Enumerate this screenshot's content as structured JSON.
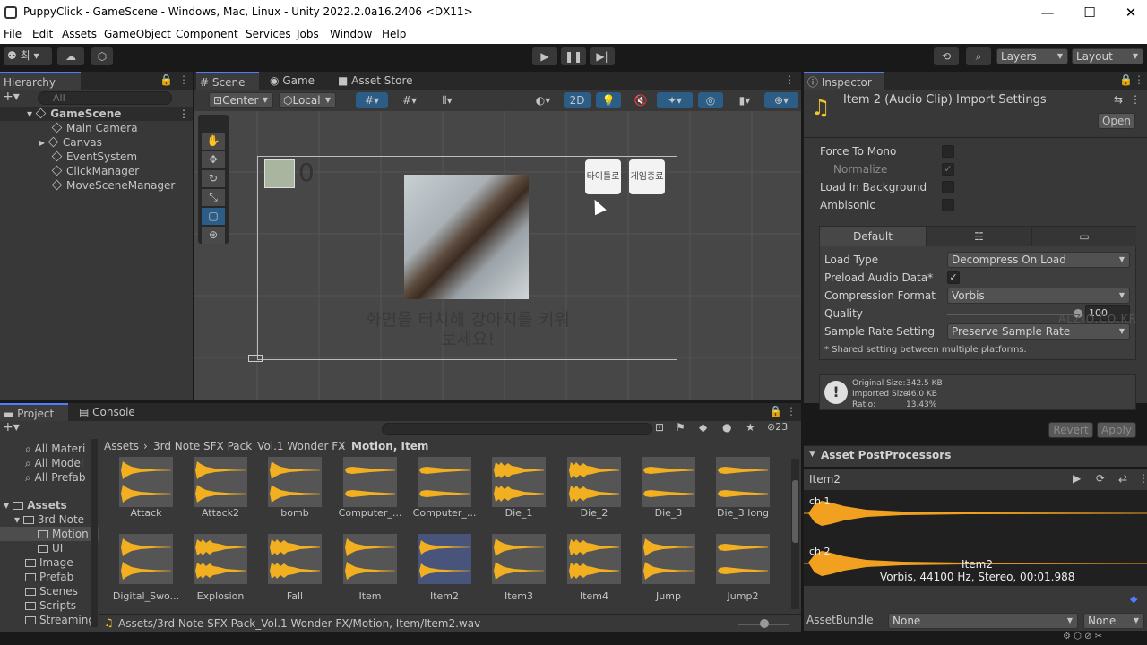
{
  "window": {
    "title": "PuppyClick - GameScene - Windows, Mac, Linux - Unity 2022.2.0a16.2406 <DX11>",
    "minimize": "—",
    "maximize": "☐",
    "close": "✕"
  },
  "menu": [
    "File",
    "Edit",
    "Assets",
    "GameObject",
    "Component",
    "Services",
    "Jobs",
    "Window",
    "Help"
  ],
  "toolbar": {
    "account": "최",
    "layers": "Layers",
    "layout": "Layout"
  },
  "hierarchy": {
    "tab": "Hierarchy",
    "search_placeholder": "All",
    "scene": "GameScene",
    "items": [
      "Main Camera",
      "Canvas",
      "EventSystem",
      "ClickManager",
      "MoveSceneManager"
    ]
  },
  "scene_view": {
    "tabs": [
      "Scene",
      "Game",
      "Asset Store"
    ],
    "pivot": "Center",
    "space": "Local",
    "mode_2d": "2D",
    "score": "0",
    "button_title": "타이틀로",
    "button_quit": "게임종료",
    "instruction": "화면을 터치해 강아지를 키워보세요!"
  },
  "inspector": {
    "tab": "Inspector",
    "title": "Item 2 (Audio Clip) Import Settings",
    "open": "Open",
    "force_to_mono": "Force To Mono",
    "normalize": "Normalize",
    "load_in_background": "Load In Background",
    "ambisonic": "Ambisonic",
    "platform_default": "Default",
    "load_type_label": "Load Type",
    "load_type": "Decompress On Load",
    "preload_label": "Preload Audio Data*",
    "compression_label": "Compression Format",
    "compression": "Vorbis",
    "quality_label": "Quality",
    "quality": "100",
    "quality_fraction": 1.0,
    "sample_rate_label": "Sample Rate Setting",
    "sample_rate": "Preserve Sample Rate",
    "shared_note": "* Shared setting between multiple platforms.",
    "original_size": "Original Size:",
    "original_size_val": "342.5 KB",
    "imported_size": "Imported Size:",
    "imported_size_val": "46.0 KB",
    "ratio": "Ratio:",
    "ratio_val": "13.43%",
    "revert": "Revert",
    "apply": "Apply",
    "postprocessors": "Asset PostProcessors",
    "watermark": "ALZIO.CO.KR"
  },
  "preview": {
    "name": "Item2",
    "ch1": "ch 1",
    "ch2": "ch 2",
    "clip_name": "Item2",
    "info": "Vorbis, 44100 Hz, Stereo, 00:01.988",
    "assetbundle_label": "AssetBundle",
    "assetbundle": "None",
    "variant": "None"
  },
  "project": {
    "tabs": [
      "Project",
      "Console"
    ],
    "hidden_count": "23",
    "favorites": [
      "All Materi",
      "All Model",
      "All Prefab"
    ],
    "assets_root": "Assets",
    "tree": [
      "3rd Note",
      "Motion",
      "UI",
      "Image",
      "Prefab",
      "Scenes",
      "Scripts",
      "Streaming"
    ],
    "breadcrumb": [
      "Assets",
      "3rd Note SFX Pack_Vol.1 Wonder FX",
      "Motion, Item"
    ],
    "row1": [
      "Attack",
      "Attack2",
      "bomb",
      "Computer_...",
      "Computer_...",
      "Die_1",
      "Die_2",
      "Die_3",
      "Die_3 long"
    ],
    "row2": [
      "Digital_Swo...",
      "Explosion",
      "Fall",
      "Item",
      "Item2",
      "Item3",
      "Item4",
      "Jump",
      "Jump2"
    ],
    "selected": "Item2",
    "path": "Assets/3rd Note SFX Pack_Vol.1 Wonder FX/Motion, Item/Item2.wav"
  },
  "colors": {
    "accent": "#4c7eff",
    "waveform": "#f2a020",
    "selection": "#2c5d87"
  }
}
